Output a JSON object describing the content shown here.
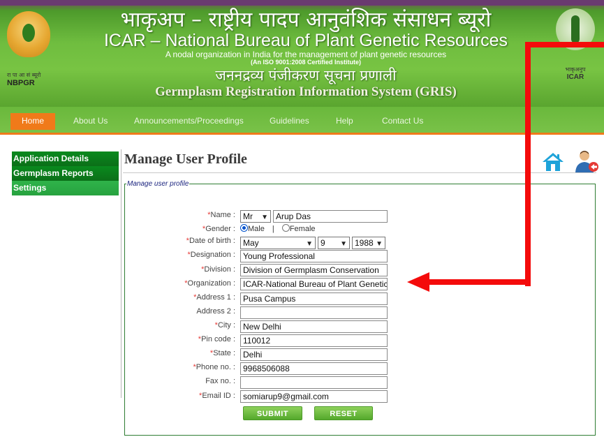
{
  "header": {
    "title_hindi": "भाकृअप – राष्ट्रीय पादप आनुवंशिक संसाधन ब्यूरो",
    "title_english": "ICAR – National Bureau of Plant Genetic Resources",
    "subtitle": "A nodal organization in India for the management of plant genetic resources",
    "iso": "(An ISO 9001:2008 Certified Institute)",
    "system_hindi": "जननद्रव्य पंजीकरण सूचना प्रणाली",
    "system_english": "Germplasm Registration Information System (GRIS)",
    "left_logo_hindi": "रा पा आ सं ब्यूरो",
    "left_logo_text": "NBPGR",
    "right_logo_hindi": "भाकृअनुप",
    "right_logo_text": "ICAR"
  },
  "nav": {
    "items": [
      {
        "label": "Home"
      },
      {
        "label": "About Us"
      },
      {
        "label": "Announcements/Proceedings"
      },
      {
        "label": "Guidelines"
      },
      {
        "label": "Help"
      },
      {
        "label": "Contact Us"
      }
    ]
  },
  "sidebar": {
    "items": [
      {
        "label": "Application Details"
      },
      {
        "label": "Germplasm Reports"
      },
      {
        "label": "Settings"
      }
    ]
  },
  "main": {
    "title": "Manage User Profile",
    "fieldset_legend": "Manage user profile"
  },
  "form": {
    "name_label": "Name :",
    "title_value": "Mr",
    "name_value": "Arup Das",
    "gender_label": "Gender :",
    "gender_male": "Male",
    "gender_sep": "|",
    "gender_female": "Female",
    "gender_selected": "Male",
    "dob_label": "Date of birth :",
    "dob_month": "May",
    "dob_day": "9",
    "dob_year": "1988",
    "designation_label": "Designation :",
    "designation_value": "Young Professional",
    "division_label": "Division :",
    "division_value": "Division of Germplasm Conservation",
    "organization_label": "Organization :",
    "organization_value": "ICAR-National Bureau of Plant Genetic",
    "address1_label": "Address 1 :",
    "address1_value": "Pusa Campus",
    "address2_label": "Address 2 :",
    "address2_value": "",
    "city_label": "City :",
    "city_value": "New Delhi",
    "pincode_label": "Pin code :",
    "pincode_value": "110012",
    "state_label": "State :",
    "state_value": "Delhi",
    "phone_label": "Phone no. :",
    "phone_value": "9968506088",
    "fax_label": "Fax no. :",
    "fax_value": "",
    "email_label": "Email ID :",
    "email_value": "somiarup9@gmail.com",
    "required_marker": "*",
    "submit_label": "SUBMIT",
    "reset_label": "RESET"
  },
  "colors": {
    "nav_active": "#f07a1a",
    "sidebar_dark": "#0b6f18",
    "sidebar_light": "#2fb34a",
    "annotation_arrow": "#f40b0b",
    "required": "#e53935"
  },
  "icons": [
    "home-icon",
    "user-logout-icon",
    "nbpgr-logo",
    "icar-logo",
    "chevron-down-icon"
  ]
}
